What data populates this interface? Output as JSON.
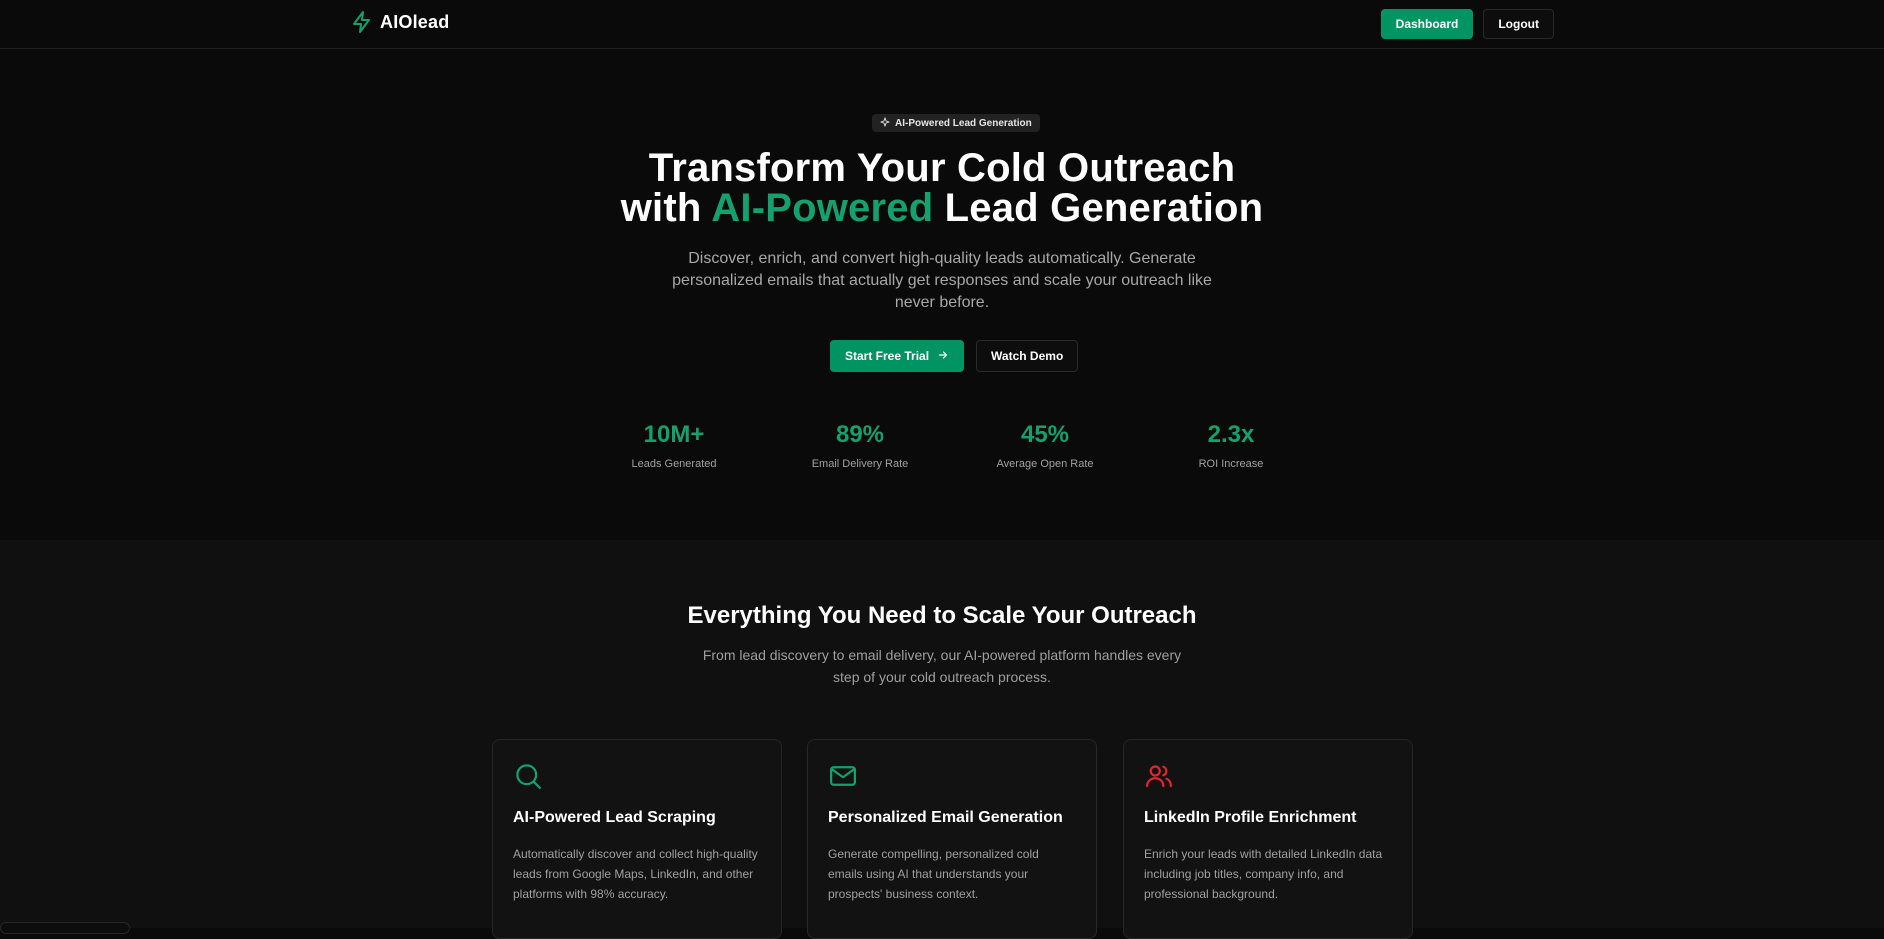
{
  "brand": {
    "name": "AIOlead",
    "accent": "#009463",
    "logo_icon": "lightning-icon"
  },
  "nav": {
    "dashboard_label": "Dashboard",
    "logout_label": "Logout"
  },
  "hero": {
    "badge_icon": "sparkle-icon",
    "badge_label": "AI-Powered Lead Generation",
    "title_line1": "Transform Your Cold Outreach",
    "title_prefix": "with ",
    "title_highlight": "AI-Powered",
    "title_suffix": " Lead Generation",
    "subtitle": "Discover, enrich, and convert high-quality leads automatically. Generate personalized emails that actually get responses and scale your outreach like never before.",
    "primary_cta": "Start Free Trial",
    "secondary_cta": "Watch Demo",
    "stats": [
      {
        "value": "10M+",
        "label": "Leads Generated"
      },
      {
        "value": "89%",
        "label": "Email Delivery Rate"
      },
      {
        "value": "45%",
        "label": "Average Open Rate"
      },
      {
        "value": "2.3x",
        "label": "ROI Increase"
      }
    ]
  },
  "features": {
    "title": "Everything You Need to Scale Your Outreach",
    "subtitle": "From lead discovery to email delivery, our AI-powered platform handles every step of your cold outreach process.",
    "cards": [
      {
        "icon": "search-icon",
        "title": "AI-Powered Lead Scraping",
        "description": "Automatically discover and collect high-quality leads from Google Maps, LinkedIn, and other platforms with 98% accuracy."
      },
      {
        "icon": "mail-icon",
        "title": "Personalized Email Generation",
        "description": "Generate compelling, personalized cold emails using AI that understands your prospects' business context."
      },
      {
        "icon": "users-icon",
        "title": "LinkedIn Profile Enrichment",
        "description": "Enrich your leads with detailed LinkedIn data including job titles, company info, and professional background."
      }
    ]
  },
  "colors": {
    "background": "#0a0a0a",
    "section_background": "#101010",
    "accent_green": "#14a06f",
    "button_green": "#009463",
    "icon_red": "#e0262b"
  }
}
